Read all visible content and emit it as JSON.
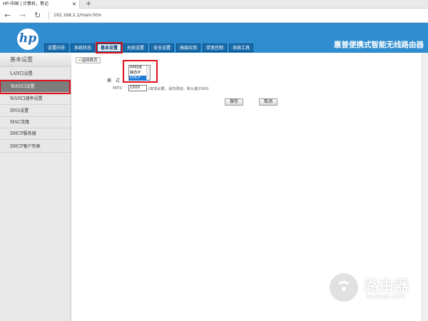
{
  "browser": {
    "tab_title": "HP-中国 | 计算机，笔记",
    "tab_close": "✕",
    "new_tab": "+",
    "back": "←",
    "forward": "→",
    "reload": "↻",
    "url": "192.168.2.1/main.htm"
  },
  "router": {
    "logo": "hp",
    "brand_title": "惠普便携式智能无线路由器",
    "tabs": [
      {
        "label": "设置向导"
      },
      {
        "label": "系统状态"
      },
      {
        "label": "基本设置"
      },
      {
        "label": "无线设置"
      },
      {
        "label": "安全设置"
      },
      {
        "label": "高级应用"
      },
      {
        "label": "带宽控制"
      },
      {
        "label": "系统工具"
      }
    ],
    "active_tab": "基本设置"
  },
  "sidebar": {
    "title": "基本设置",
    "items": [
      {
        "label": "LAN口设置"
      },
      {
        "label": "WAN口设置"
      },
      {
        "label": "WAN口速率设置"
      },
      {
        "label": "DNS设置"
      },
      {
        "label": "MAC克隆"
      },
      {
        "label": "DHCP服务器"
      },
      {
        "label": "DHCP客户列表"
      }
    ],
    "active_item": "WAN口设置"
  },
  "main": {
    "back_button": "返回首页",
    "mode_label": "模式",
    "mode_options": [
      "PPPOE",
      "静态IP",
      "DHCP"
    ],
    "mode_selected": "DHCP",
    "mtu_label": "MTU",
    "mtu_value": "1500",
    "mtu_hint": "(如非必要，请勿改动，默认值1500)",
    "save_button": "保存",
    "cancel_button": "取消"
  },
  "watermark": {
    "text": "路由器",
    "sub": "luyouqi.com"
  },
  "colors": {
    "header_blue": "#2f8dd0",
    "highlight_red": "#e0101a",
    "selected_option": "#1c7ad8"
  }
}
